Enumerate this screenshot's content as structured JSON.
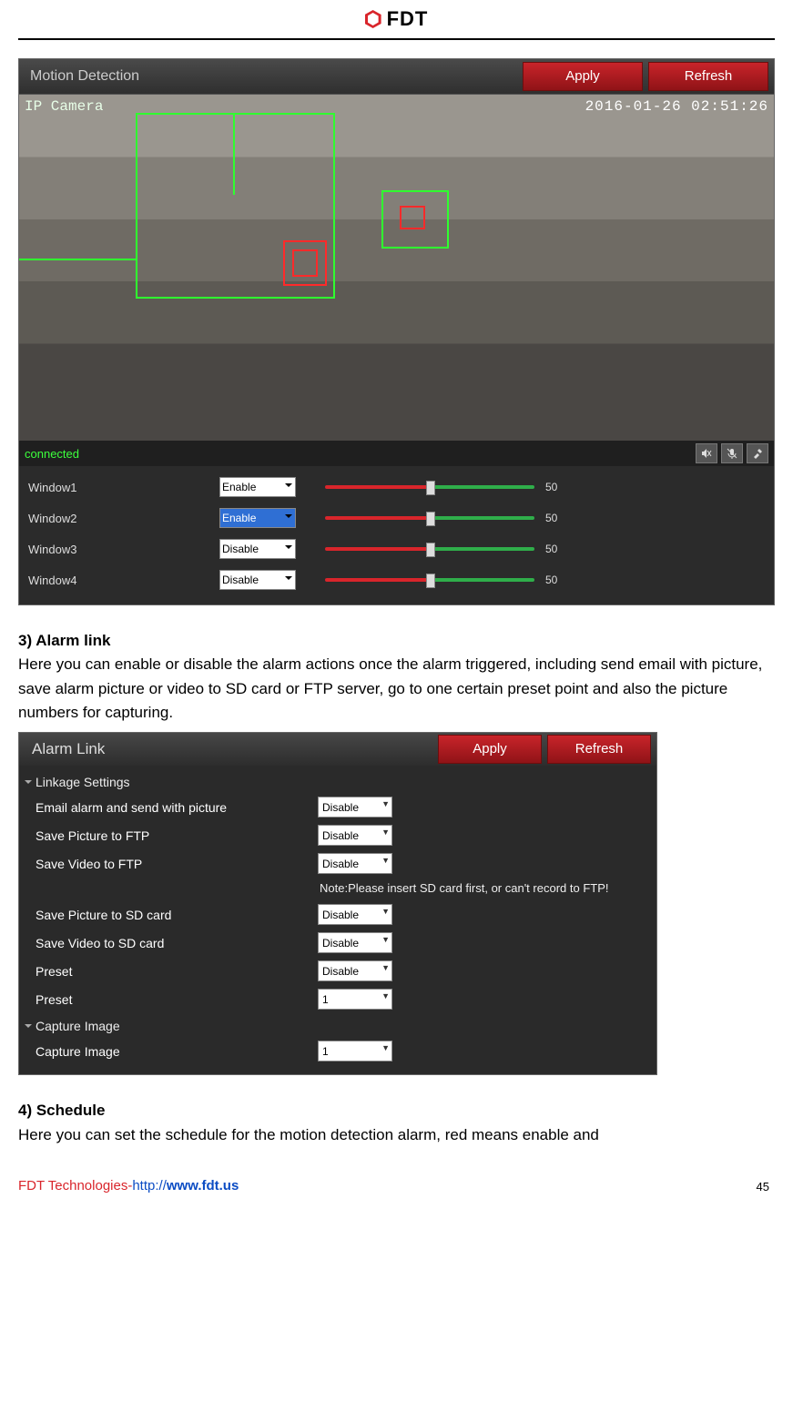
{
  "brand": "FDT",
  "motion": {
    "title": "Motion Detection",
    "apply": "Apply",
    "refresh": "Refresh",
    "osd_left": "IP Camera",
    "osd_right": "2016-01-26 02:51:26",
    "status": "connected",
    "icons": {
      "mute": "mute-icon",
      "mic": "mic-off-icon",
      "tools": "tools-icon"
    },
    "windows": [
      {
        "label": "Window1",
        "value": "Enable",
        "open": false,
        "slider": 50
      },
      {
        "label": "Window2",
        "value": "Enable",
        "open": true,
        "slider": 50
      },
      {
        "label": "Window3",
        "value": "Disable",
        "open": false,
        "slider": 50
      },
      {
        "label": "Window4",
        "value": "Disable",
        "open": false,
        "slider": 50
      }
    ]
  },
  "section3": {
    "heading": "3) Alarm link",
    "body": "Here you can enable or disable the alarm actions once the alarm triggered, including send email with picture, save alarm picture or video to SD card or FTP server, go to one certain preset point and also the picture numbers for capturing."
  },
  "alarm": {
    "title": "Alarm Link",
    "apply": "Apply",
    "refresh": "Refresh",
    "subhead1": "Linkage Settings",
    "rows": [
      {
        "label": "Email alarm and send with picture",
        "value": "Disable"
      },
      {
        "label": "Save Picture to FTP",
        "value": "Disable"
      },
      {
        "label": "Save Video to FTP",
        "value": "Disable"
      }
    ],
    "note": "Note:Please insert SD card first, or can't record to FTP!",
    "rows2": [
      {
        "label": "Save Picture to SD card",
        "value": "Disable"
      },
      {
        "label": "Save Video to SD card",
        "value": "Disable"
      },
      {
        "label": "Preset",
        "value": "Disable"
      },
      {
        "label": "Preset",
        "value": "1"
      }
    ],
    "subhead2": "Capture Image",
    "rows3": [
      {
        "label": "Capture Image",
        "value": "1"
      }
    ]
  },
  "section4": {
    "heading": "4) Schedule",
    "body": "Here you can set the schedule for the motion detection alarm, red means enable and"
  },
  "footer": {
    "company": "FDT Technologies-",
    "proto": "http://",
    "domain": "www.fdt.us",
    "page": "45"
  }
}
